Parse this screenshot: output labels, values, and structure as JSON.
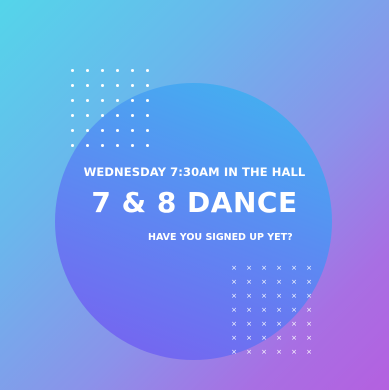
{
  "poster": {
    "line1": "WEDNESDAY 7:30AM IN THE HALL",
    "title": "7 & 8 DANCE",
    "line3": "HAVE YOU SIGNED UP YET?"
  },
  "colors": {
    "background_start": "#54d5ea",
    "background_end": "#b460e0",
    "circle_top": "#3fb6f0",
    "circle_bottom": "#7a5ef0",
    "text": "#ffffff"
  },
  "decorations": {
    "dot_grid_icon": "dot-grid",
    "cross_grid_icon": "x-grid",
    "cross_glyph": "×"
  }
}
